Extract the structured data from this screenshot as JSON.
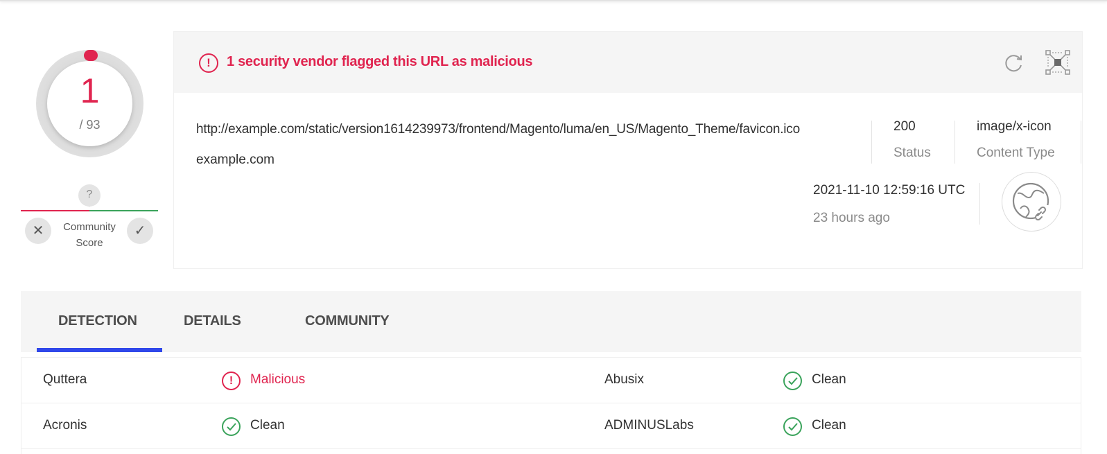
{
  "score": {
    "detections": "1",
    "total": "/ 93"
  },
  "community": {
    "question": "?",
    "label": "Community Score",
    "label_line1": "Community",
    "label_line2": "Score",
    "negative": "✕",
    "positive": "✓"
  },
  "alert": {
    "icon": "!",
    "text": "1 security vendor flagged this URL as malicious"
  },
  "header": {
    "url": "http://example.com/static/version1614239973/frontend/Magento/luma/en_US/Magento_Theme/favicon.ico",
    "domain": "example.com",
    "status_value": "200",
    "status_label": "Status",
    "content_type_value": "image/x-icon",
    "content_type_label": "Content Type",
    "analysis_date": "2021-11-10 12:59:16 UTC",
    "analysis_relative": "23 hours ago"
  },
  "tabs": [
    {
      "label": "DETECTION",
      "active": true
    },
    {
      "label": "DETAILS",
      "active": false
    },
    {
      "label": "COMMUNITY",
      "active": false
    }
  ],
  "detections": [
    {
      "left_vendor": "Quttera",
      "left_result": "Malicious",
      "left_status": "malicious",
      "right_vendor": "Abusix",
      "right_result": "Clean",
      "right_status": "clean"
    },
    {
      "left_vendor": "Acronis",
      "left_result": "Clean",
      "left_status": "clean",
      "right_vendor": "ADMINUSLabs",
      "right_result": "Clean",
      "right_status": "clean"
    }
  ],
  "colors": {
    "malicious": "#e0244f",
    "clean": "#3aa35b",
    "accent": "#3048ea"
  }
}
